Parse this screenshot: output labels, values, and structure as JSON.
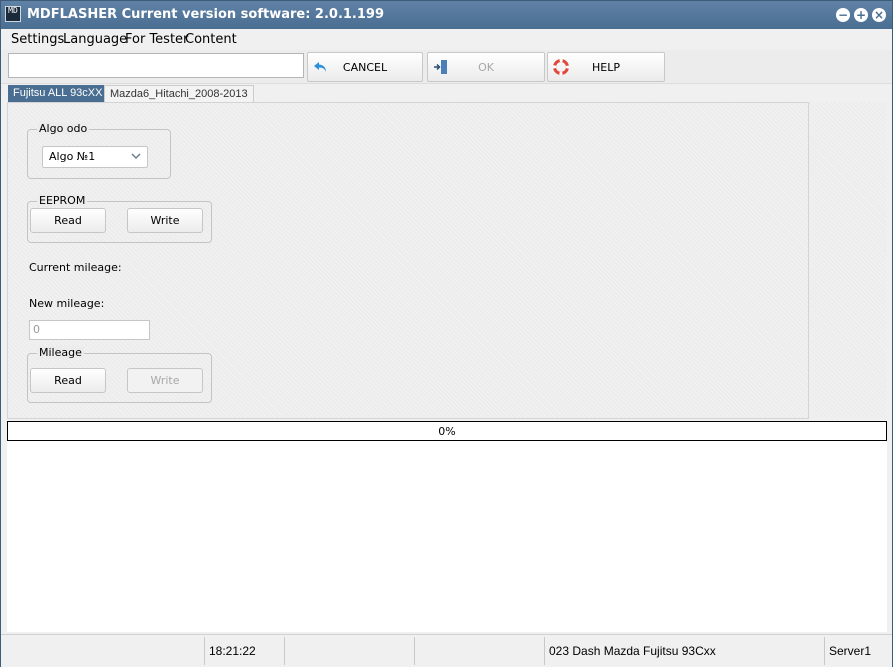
{
  "window": {
    "title": "MDFLASHER  Current version software: 2.0.1.199",
    "icon_text": "MD",
    "controls": [
      "minimize-icon",
      "maximize-icon",
      "close-icon"
    ],
    "controls_glyphs": [
      "−",
      "+",
      "×"
    ]
  },
  "menu": {
    "items": [
      {
        "label": "Settings"
      },
      {
        "label": "Language"
      },
      {
        "label": "For Tester"
      },
      {
        "label": "Content"
      }
    ]
  },
  "toolbar": {
    "input_value": "",
    "cancel_label": "CANCEL",
    "ok_label": "OK",
    "help_label": "HELP",
    "cancel_icon": "undo-arrow-icon",
    "ok_icon": "exit-door-icon",
    "help_icon": "lifebuoy-icon",
    "colors": {
      "accent": "#4a6d92",
      "cancel_icon": "#2b8fd9",
      "help_icon": "#e0483c"
    }
  },
  "tabs": [
    {
      "label": "Fujitsu ALL 93cXX",
      "active": true
    },
    {
      "label": "Mazda6_Hitachi_2008-2013",
      "active": false
    }
  ],
  "panel": {
    "algo_group_title": "Algo odo",
    "algo_select_value": "Algo №1",
    "eeprom_group_title": "EEPROM",
    "eeprom_read_label": "Read",
    "eeprom_write_label": "Write",
    "current_mileage_label": "Current mileage:",
    "current_mileage_value": "",
    "new_mileage_label": "New mileage:",
    "new_mileage_value": "0",
    "mileage_group_title": "Mileage",
    "mileage_read_label": "Read",
    "mileage_write_label": "Write",
    "mileage_write_enabled": false
  },
  "progress": {
    "percent": 0,
    "label": "0%"
  },
  "log": {
    "lines": []
  },
  "statusbar": {
    "cells": [
      "",
      "18:21:22",
      "",
      "",
      "023 Dash Mazda Fujitsu 93Cxx",
      "Server1"
    ]
  }
}
